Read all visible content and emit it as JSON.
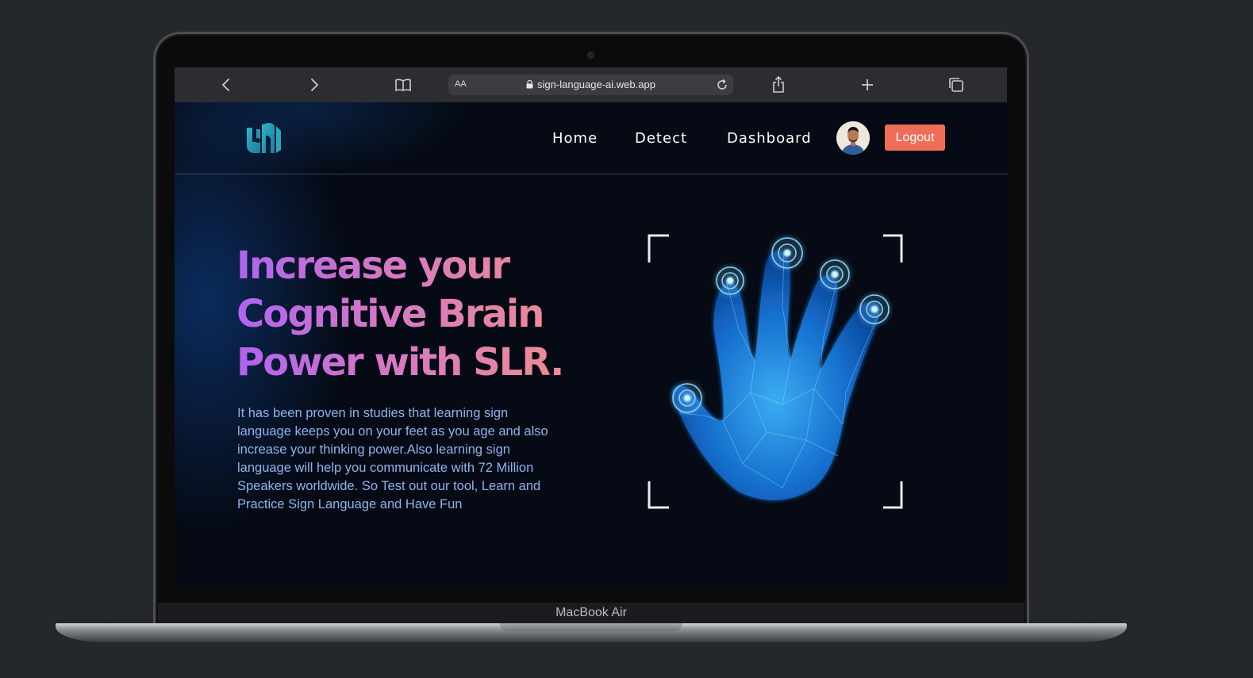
{
  "browser": {
    "address_prefix": "AA",
    "url": "sign-language-ai.web.app"
  },
  "site": {
    "nav": [
      {
        "label": "Home"
      },
      {
        "label": "Detect"
      },
      {
        "label": "Dashboard"
      }
    ],
    "logout_label": "Logout",
    "hero": {
      "title": "Increase your Cognitive Brain Power with SLR.",
      "body": "It has been proven in studies that learning sign language keeps you on your feet as you age and also increase your thinking power.Also learning sign language will help you communicate with 72 Million Speakers worldwide. So Test out our tool, Learn and Practice Sign Language and Have Fun"
    }
  },
  "device": {
    "label": "MacBook Air"
  },
  "colors": {
    "page_bg": "#24272b",
    "site_bg": "#050a14",
    "logout_bg": "#ef6d57",
    "title_gradient_start": "#b063f0",
    "title_gradient_end": "#f08e8e",
    "body_text": "#8fb3ee",
    "hand_glow": "#1e8fff"
  },
  "icons": [
    "back-icon",
    "forward-icon",
    "bookmarks-icon",
    "lock-icon",
    "reload-icon",
    "share-icon",
    "new-tab-icon",
    "tabs-icon"
  ]
}
